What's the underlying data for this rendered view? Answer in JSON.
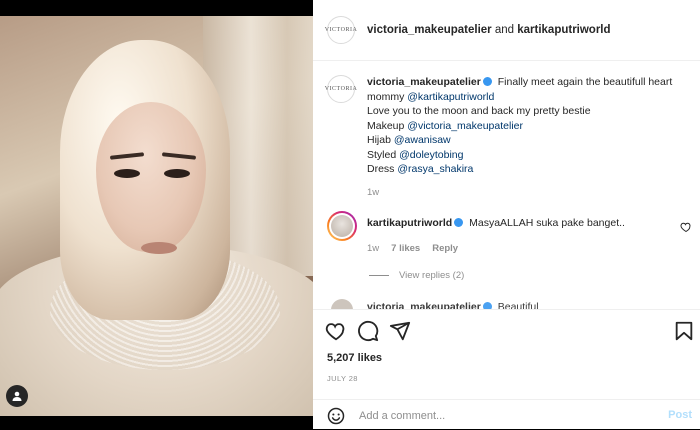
{
  "post": {
    "header": {
      "user": "victoria_makeupatelier",
      "joiner": " and ",
      "collaborator": "kartikaputriworld",
      "avatar_text": "VICTORIA"
    },
    "caption": {
      "user": "victoria_makeupatelier",
      "line1": " Finally meet again the beautifull heart mommy ",
      "mention1": "@kartikaputriworld",
      "line2": "Love you to the moon and back my pretty bestie",
      "line3_prefix": "Makeup ",
      "mention_makeup": "@victoria_makeupatelier",
      "line4_prefix": "Hijab ",
      "mention_hijab": "@awanisaw",
      "line5_prefix": "Styled ",
      "mention_styled": "@doleytobing",
      "line6_prefix": "Dress ",
      "mention_dress": "@rasya_shakira",
      "time": "1w"
    },
    "comment1": {
      "user": "kartikaputriworld",
      "text": " MasyaALLAH suka pake banget..",
      "time": "1w",
      "likes": "7 likes",
      "reply": "Reply",
      "view_replies": "View replies (2)"
    },
    "comment2": {
      "user": "victoria_makeupatelier",
      "text": " Beautiful"
    },
    "likes": "5,207 likes",
    "date": "JULY 28",
    "add_comment_placeholder": "Add a comment...",
    "post_button": "Post",
    "colors": {
      "verified": "#3897f0",
      "mention": "#00376b",
      "post_disabled": "#b2dffc"
    }
  }
}
